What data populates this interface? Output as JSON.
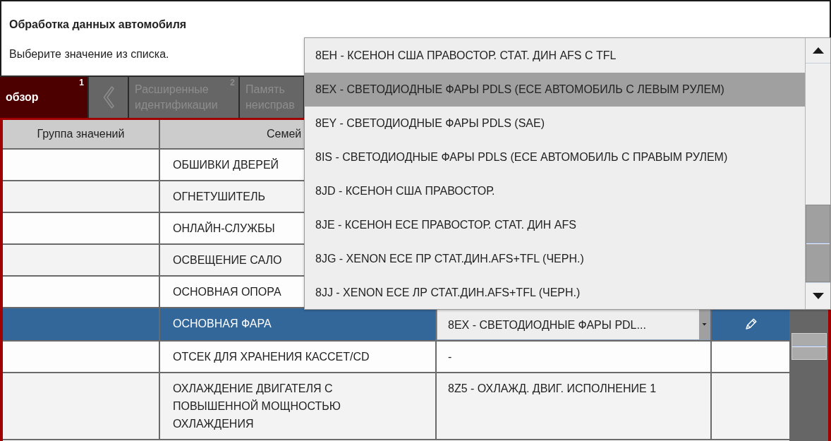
{
  "header": {
    "title": "Обработка данных автомобиля",
    "instruction": "Выберите значение из списка."
  },
  "tabs": [
    {
      "kind": "text",
      "label": "обзор",
      "number": "1",
      "selected": true,
      "disabled": false
    },
    {
      "kind": "back",
      "selected": false,
      "disabled": true
    },
    {
      "kind": "text",
      "label": "Расширенные идентификации",
      "number": "2",
      "selected": false,
      "disabled": true
    },
    {
      "kind": "text",
      "label": "Память неисправ",
      "selected": false,
      "disabled": true
    }
  ],
  "table": {
    "columns": [
      "Группа значений",
      "Семей"
    ],
    "rows": [
      {
        "kind": "text",
        "name": "ОБШИВКИ ДВЕРЕЙ",
        "selected": false
      },
      {
        "kind": "text",
        "name": "ОГНЕТУШИТЕЛЬ",
        "selected": false
      },
      {
        "kind": "text",
        "name": "ОНЛАЙН-СЛУЖБЫ",
        "selected": false
      },
      {
        "kind": "text",
        "name": "ОСВЕЩЕНИЕ САЛО",
        "selected": false
      },
      {
        "kind": "text",
        "name": "ОСНОВНАЯ ОПОРА",
        "selected": false
      },
      {
        "kind": "dropdown",
        "name": "ОСНОВНАЯ ФАРА",
        "value": "8EX - СВЕТОДИОДНЫЕ ФАРЫ PDL...",
        "selected": true
      },
      {
        "kind": "text",
        "name": "ОТСЕК ДЛЯ ХРАНЕНИЯ КАССЕТ/CD",
        "value": "-",
        "selected": false
      },
      {
        "kind": "text",
        "name": "ОХЛАЖДЕНИЕ ДВИГАТЕЛЯ С ПОВЫШЕННОЙ МОЩНОСТЬЮ ОХЛАЖДЕНИЯ",
        "value": "8Z5 - ОХЛАЖД. ДВИГ. ИСПОЛНЕНИЕ 1",
        "selected": false
      }
    ]
  },
  "dropdown_list": {
    "options": [
      {
        "label": "8EH - КСЕНОН США ПРАВОСТОР. СТАТ. ДИН AFS С TFL",
        "selected": false
      },
      {
        "label": "8EX - СВЕТОДИОДНЫЕ ФАРЫ PDLS (ECE АВТОМОБИЛЬ С ЛЕВЫМ РУЛЕМ)",
        "selected": true
      },
      {
        "label": "8EY - СВЕТОДИОДНЫЕ ФАРЫ PDLS (SAE)",
        "selected": false
      },
      {
        "label": "8IS - СВЕТОДИОДНЫЕ ФАРЫ PDLS (ECE АВТОМОБИЛЬ С ПРАВЫМ РУЛЕМ)",
        "selected": false
      },
      {
        "label": "8JD - КСЕНОН США ПРАВОСТОР.",
        "selected": false
      },
      {
        "label": "8JE - КСЕНОН ECE ПРАВОСТОР. СТАТ. ДИН AFS",
        "selected": false
      },
      {
        "label": "8JG - XENON ECE ПР СТАТ.ДИН.AFS+TFL (ЧЕРН.)",
        "selected": false
      },
      {
        "label": "8JJ - XENON ECE ЛР СТАТ.ДИН.AFS+TFL (ЧЕРН.)",
        "selected": false
      }
    ]
  }
}
